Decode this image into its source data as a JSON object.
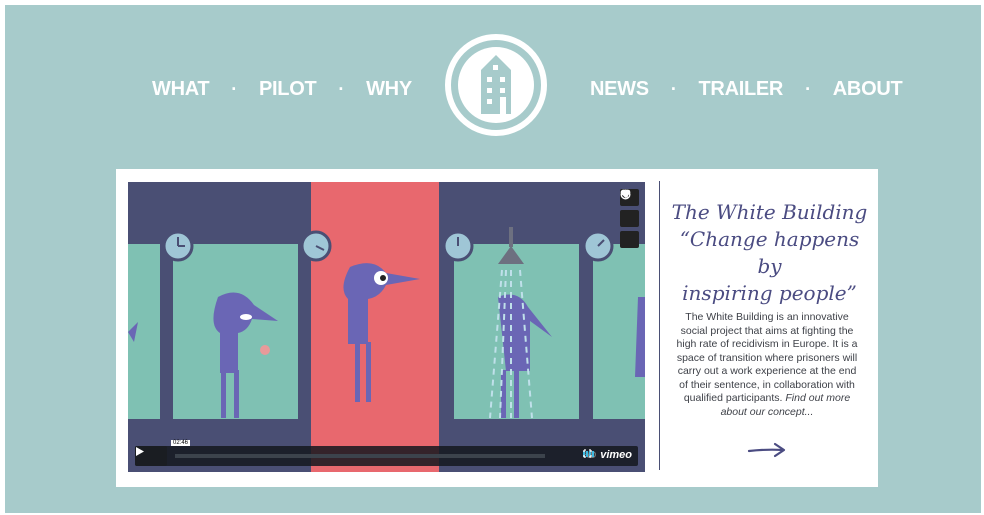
{
  "nav": {
    "left": [
      "WHAT",
      "PILOT",
      "WHY"
    ],
    "right": [
      "NEWS",
      "TRAILER",
      "ABOUT"
    ],
    "separator": "·"
  },
  "logo": {
    "icon": "house-icon"
  },
  "video": {
    "timecode": "02:46",
    "hd_label": "HD",
    "brand": "vimeo",
    "side_icons": [
      "heart-icon",
      "clock-icon",
      "send-icon"
    ]
  },
  "content": {
    "title_line1": "The White Building",
    "title_line2": "“Change happens by",
    "title_line3": "inspiring people”",
    "description": "The White Building is an innovative social project that aims at fighting the high rate of recidivism in Europe. It is a space of transition where prisoners will carry out a work experience at the end of their sentence, in collaboration with qualified participants.",
    "link_text": "Find out more about our concept...",
    "arrow": "→"
  },
  "colors": {
    "background": "#a7cbcb",
    "accent": "#4b4c82",
    "video_dark": "#4a4f74",
    "video_red": "#e8686e"
  }
}
